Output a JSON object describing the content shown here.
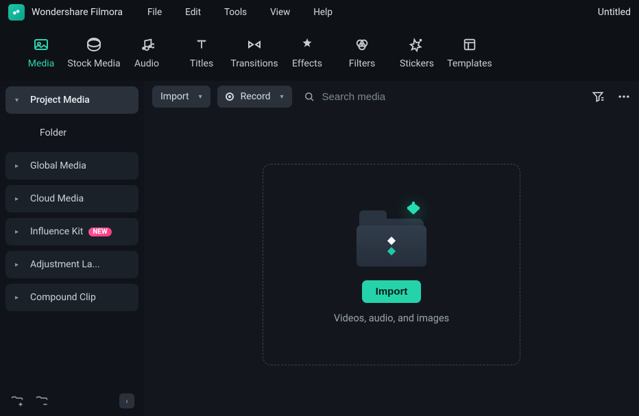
{
  "app": {
    "title": "Wondershare Filmora",
    "doc_title": "Untitled"
  },
  "menu": {
    "file": "File",
    "edit": "Edit",
    "tools": "Tools",
    "view": "View",
    "help": "Help"
  },
  "tabs": {
    "media": "Media",
    "stock_media": "Stock Media",
    "audio": "Audio",
    "titles": "Titles",
    "transitions": "Transitions",
    "effects": "Effects",
    "filters": "Filters",
    "stickers": "Stickers",
    "templates": "Templates"
  },
  "sidebar": {
    "project_media": "Project Media",
    "folder": "Folder",
    "global_media": "Global Media",
    "cloud_media": "Cloud Media",
    "influence_kit": "Influence Kit",
    "influence_badge": "NEW",
    "adjustment_layer": "Adjustment La...",
    "compound_clip": "Compound Clip"
  },
  "content_toolbar": {
    "import": "Import",
    "record": "Record",
    "search_placeholder": "Search media"
  },
  "dropzone": {
    "import_btn": "Import",
    "subtitle": "Videos, audio, and images"
  }
}
